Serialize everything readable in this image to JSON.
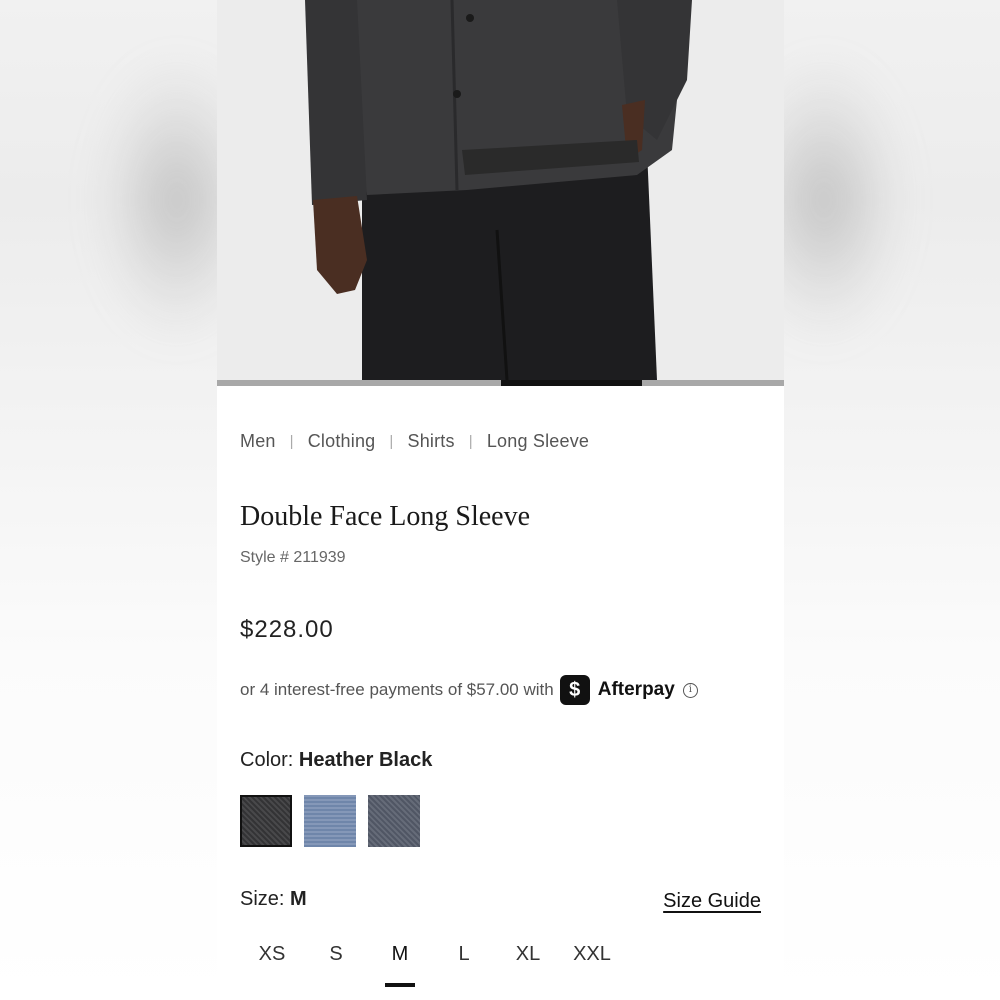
{
  "breadcrumb": {
    "items": [
      "Men",
      "Clothing",
      "Shirts",
      "Long Sleeve"
    ],
    "separator": "|"
  },
  "product": {
    "title": "Double Face Long Sleeve",
    "style": "Style # 211939",
    "price": "$228.00"
  },
  "afterpay": {
    "text": "or 4 interest-free payments of $57.00 with",
    "logo_glyph": "$",
    "brand": "Afterpay",
    "info_glyph": "i"
  },
  "color": {
    "label": "Color:",
    "selected": "Heather Black",
    "swatches": [
      {
        "name": "Heather Black",
        "color": "#3a3a3c",
        "selected": true
      },
      {
        "name": "Blue",
        "color": "#7a8fb0",
        "selected": false
      },
      {
        "name": "Grey",
        "color": "#5a6070",
        "selected": false
      }
    ]
  },
  "size": {
    "label": "Size:",
    "selected": "M",
    "guide_label": "Size Guide",
    "options": [
      "XS",
      "S",
      "M",
      "L",
      "XL",
      "XXL"
    ]
  },
  "carousel": {
    "slide_count": 4,
    "active_index": 2
  },
  "colors": {
    "shirt": "#3c3c3e",
    "pants": "#1c1c1e",
    "photo_bg": "#ececec"
  }
}
